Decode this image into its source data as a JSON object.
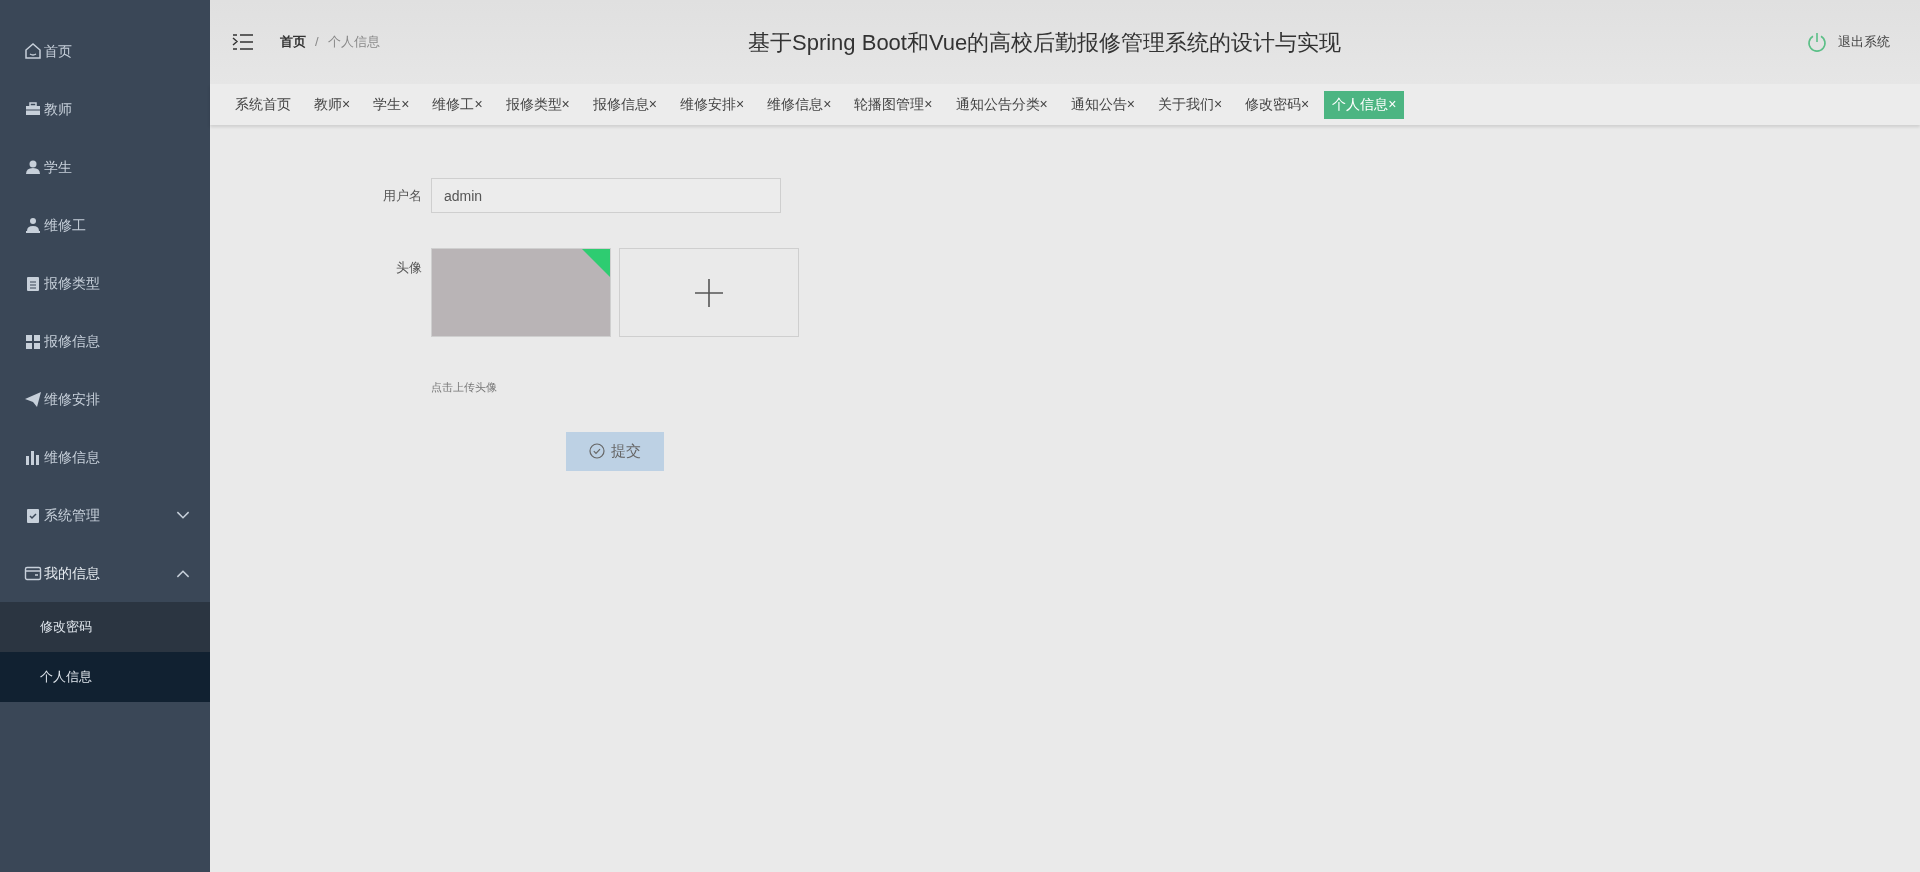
{
  "sidebar": {
    "items": [
      {
        "label": "首页"
      },
      {
        "label": "教师"
      },
      {
        "label": "学生"
      },
      {
        "label": "维修工"
      },
      {
        "label": "报修类型"
      },
      {
        "label": "报修信息"
      },
      {
        "label": "维修安排"
      },
      {
        "label": "维修信息"
      },
      {
        "label": "系统管理",
        "expanded": false
      },
      {
        "label": "我的信息",
        "expanded": true,
        "children": [
          {
            "label": "修改密码",
            "selected": false
          },
          {
            "label": "个人信息",
            "selected": true
          }
        ]
      }
    ]
  },
  "header": {
    "breadcrumb": [
      "首页",
      "个人信息"
    ],
    "separator": "/",
    "title": "基于Spring Boot和Vue的高校后勤报修管理系统的设计与实现",
    "logout": "退出系统"
  },
  "tabs": [
    {
      "label": "系统首页",
      "selected": false
    },
    {
      "label": "教师",
      "close": "×",
      "selected": false
    },
    {
      "label": "学生",
      "close": "×",
      "selected": false
    },
    {
      "label": "维修工",
      "close": "×",
      "selected": false
    },
    {
      "label": "报修类型",
      "close": "×",
      "selected": false
    },
    {
      "label": "报修信息",
      "close": "×",
      "selected": false
    },
    {
      "label": "维修安排",
      "close": "×",
      "selected": false
    },
    {
      "label": "维修信息",
      "close": "×",
      "selected": false
    },
    {
      "label": "轮播图管理",
      "close": "×",
      "selected": false
    },
    {
      "label": "通知公告分类",
      "close": "×",
      "selected": false
    },
    {
      "label": "通知公告",
      "close": "×",
      "selected": false
    },
    {
      "label": "关于我们",
      "close": "×",
      "selected": false
    },
    {
      "label": "修改密码",
      "close": "×",
      "selected": false
    },
    {
      "label": "个人信息",
      "close": "×",
      "selected": true
    }
  ],
  "form": {
    "username_label": "用户名",
    "username": "admin",
    "avatar_label": "头像",
    "avatar_hint": "点击上传头像",
    "submit": "提交"
  }
}
